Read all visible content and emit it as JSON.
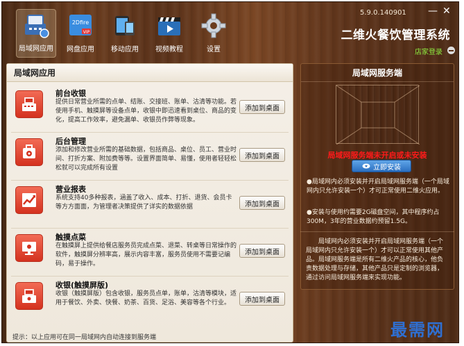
{
  "window": {
    "version": "5.9.0.140901",
    "title": "二维火餐饮管理系统",
    "login_link": "店家登录",
    "minimize": "—",
    "close": "✕"
  },
  "nav": [
    {
      "label": "局域网应用",
      "icon": "cash-register-icon",
      "active": true
    },
    {
      "label": "网盘应用",
      "icon": "vip-cloud-icon",
      "active": false
    },
    {
      "label": "移动应用",
      "icon": "mobile-devices-icon",
      "active": false
    },
    {
      "label": "视频教程",
      "icon": "video-clapper-icon",
      "active": false
    },
    {
      "label": "设置",
      "icon": "gear-icon",
      "active": false
    }
  ],
  "left": {
    "title": "局域网应用",
    "tip": "提示：以上应用可在同一局域网内自动连接到服务端",
    "add_label": "添加到桌面",
    "apps": [
      {
        "name": "前台收银",
        "desc": "提供日常营业所需的点单、结账、交接班、账单、沽清等功能。若使用手机、触摸屏等设备点单，收银中即迅速看到桌位、商品的变化，提高工作效率，避免漏单、收银员作弊等现象。",
        "icon": "register-icon"
      },
      {
        "name": "后台管理",
        "desc": "添加和修改营业所需的基础数据，包括商品、桌位、员工、营业时间、打折方案、附加费等等。设置界面简单、易懂，使用者轻轻松松就可以完成所有设置",
        "icon": "gear-bag-icon"
      },
      {
        "name": "营业报表",
        "desc": "系统支持40多种报表，涵盖了收入、成本、打折、退货、会员卡等方方面面，为管理者决策提供了详实的数据依据",
        "icon": "chart-icon"
      },
      {
        "name": "触摸点菜",
        "desc": "在触摸屏上提供给餐店服务员完成点菜、退菜、转桌等日常操作的软件，触摸屏分辨率高，展示内容丰富，服务员使用不需要记编码，易于操作。",
        "icon": "touch-screen-icon"
      },
      {
        "name": "收银(触摸屏版)",
        "desc": "收银（触摸屏版）包含收银，服务员点单，账单，沽清等模块，适用于餐饮、外卖、快餐、奶茶、百货、足浴、美容等各个行业。",
        "icon": "register-touch-icon"
      }
    ]
  },
  "right": {
    "title": "局域网服务端",
    "warning": "局域网服务端未开启或未安装",
    "install_label": "立即安装",
    "note1": "●局域网内必须安装并开启局域网服务端（一个局域网内只允许安装一个）才可正常使用二维火应用。",
    "note2": "●安装与使用约需要2G磁盘空间，其中程序约占300M，3年的营业数据约预留1.5G。",
    "desc": "局域网内必须安装并开启局域网服务端（一个局域网内只允许安装一个）才可以正常使用其他产品。局域网服务端是所有二维火产品的核心，他负责数据处理与存储，其他产品只是定制的浏览器，通过访问局域网服务端来实现功能。"
  },
  "watermark": "最需网",
  "colors": {
    "accent_red": "#d4321f",
    "install_blue": "#2b6fc0",
    "login_green": "#8eea40",
    "warning_red": "#ff1a1a"
  }
}
